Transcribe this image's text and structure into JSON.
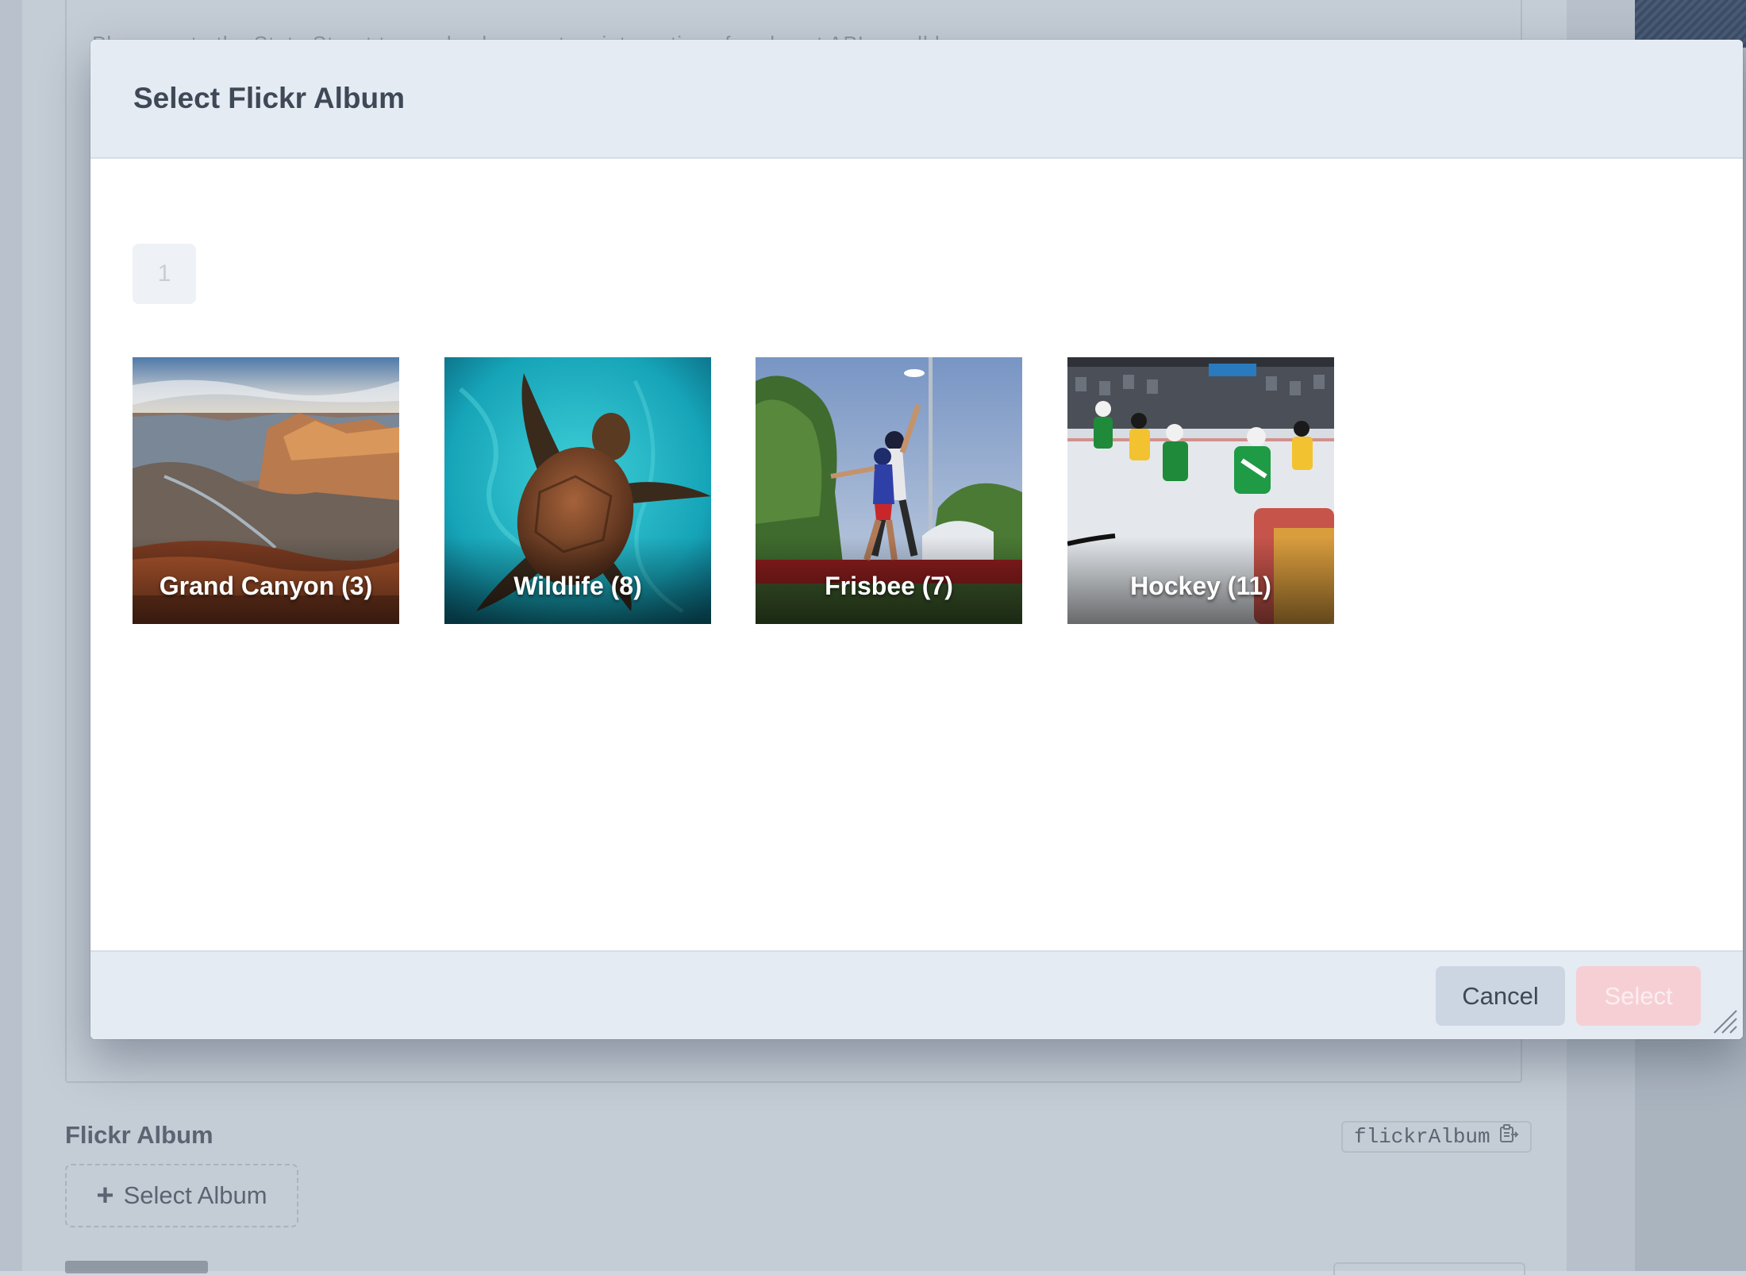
{
  "background": {
    "cut_text": "Please note the State Street team also has custom integrations for almost API a well known",
    "field_label": "Flickr Album",
    "field_handle": "flickrAlbum",
    "select_album_label": "Select Album"
  },
  "modal": {
    "title": "Select Flickr Album",
    "pagination": {
      "current_page": "1"
    },
    "albums": [
      {
        "label": "Grand Canyon (3)"
      },
      {
        "label": "Wildlife (8)"
      },
      {
        "label": "Frisbee (7)"
      },
      {
        "label": "Hockey (11)"
      }
    ],
    "footer": {
      "cancel_label": "Cancel",
      "select_label": "Select"
    }
  },
  "colors": {
    "select_button": "#f6cfd5",
    "header": "#e4ebf3"
  }
}
